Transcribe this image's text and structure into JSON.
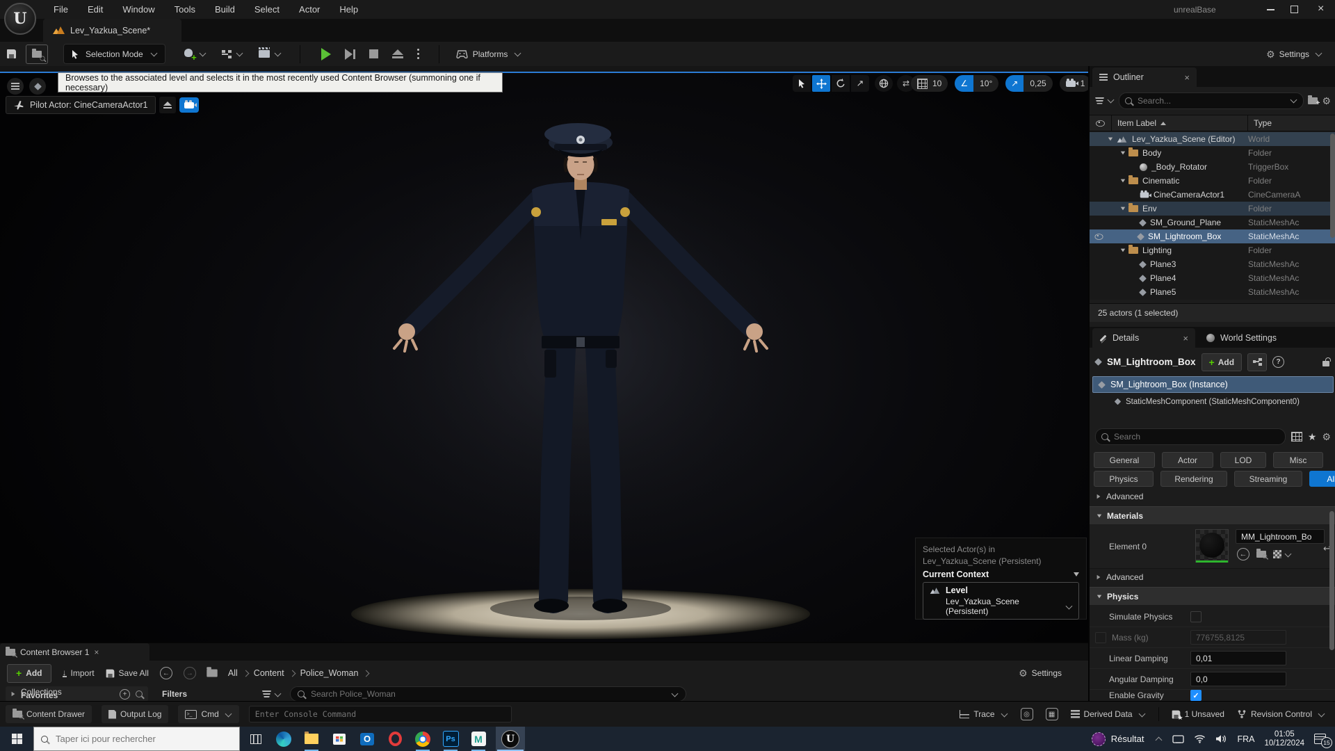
{
  "window": {
    "title": "unrealBase",
    "menu": [
      "File",
      "Edit",
      "Window",
      "Tools",
      "Build",
      "Select",
      "Actor",
      "Help"
    ],
    "tab": "Lev_Yazkua_Scene*"
  },
  "toolbar": {
    "selection_mode": "Selection Mode",
    "platforms": "Platforms",
    "settings": "Settings"
  },
  "tooltip": "Browses to the associated level and selects it in the most recently used Content Browser (summoning one if necessary)",
  "viewport": {
    "pilot": "Pilot Actor: CineCameraActor1",
    "grid_snap": "10",
    "angle_snap": "10°",
    "scale_snap": "0,25",
    "camera_speed": "1",
    "popup": {
      "line1": "Selected Actor(s) in",
      "line2": "Lev_Yazkua_Scene (Persistent)",
      "context": "Current Context",
      "level_label": "Level",
      "level_value": "Lev_Yazkua_Scene (Persistent)"
    }
  },
  "outliner": {
    "title": "Outliner",
    "search_placeholder": "Search...",
    "col_item": "Item Label",
    "col_type": "Type",
    "rows": [
      {
        "label": "Lev_Yazkua_Scene (Editor)",
        "type": "World"
      },
      {
        "label": "Body",
        "type": "Folder"
      },
      {
        "label": "_Body_Rotator",
        "type": "TriggerBox"
      },
      {
        "label": "Cinematic",
        "type": "Folder"
      },
      {
        "label": "CineCameraActor1",
        "type": "CineCameraA"
      },
      {
        "label": "Env",
        "type": "Folder"
      },
      {
        "label": "SM_Ground_Plane",
        "type": "StaticMeshAc"
      },
      {
        "label": "SM_Lightroom_Box",
        "type": "StaticMeshAc"
      },
      {
        "label": "Lighting",
        "type": "Folder"
      },
      {
        "label": "Plane3",
        "type": "StaticMeshAc"
      },
      {
        "label": "Plane4",
        "type": "StaticMeshAc"
      },
      {
        "label": "Plane5",
        "type": "StaticMeshAc"
      }
    ],
    "footer": "25 actors (1 selected)"
  },
  "details": {
    "tab_details": "Details",
    "tab_world": "World Settings",
    "object_name": "SM_Lightroom_Box",
    "add_button": "Add",
    "instance_label": "SM_Lightroom_Box (Instance)",
    "component_label": "StaticMeshComponent (StaticMeshComponent0)",
    "search_placeholder": "Search",
    "chips": [
      "General",
      "Actor",
      "LOD",
      "Misc",
      "Physics",
      "Rendering",
      "Streaming",
      "All"
    ],
    "advanced_label": "Advanced",
    "materials_label": "Materials",
    "element_label": "Element 0",
    "material_name": "MM_Lightroom_Bo",
    "physics_label": "Physics",
    "simulate_physics_label": "Simulate Physics",
    "mass_label": "Mass (kg)",
    "mass_value": "776755,8125",
    "linear_damping_label": "Linear Damping",
    "linear_damping_value": "0,01",
    "angular_damping_label": "Angular Damping",
    "angular_damping_value": "0,0",
    "enable_gravity_label": "Enable Gravity"
  },
  "content_browser": {
    "tab": "Content Browser 1",
    "add": "Add",
    "import": "Import",
    "save_all": "Save All",
    "breadcrumb": [
      "All",
      "Content",
      "Police_Woman"
    ],
    "settings": "Settings",
    "favorites": "Favorites",
    "collections": "Collections",
    "filters": "Filters",
    "search_placeholder": "Search Police_Woman"
  },
  "status_bar": {
    "content_drawer": "Content Drawer",
    "output_log": "Output Log",
    "cmd": "Cmd",
    "console_placeholder": "Enter Console Command",
    "trace": "Trace",
    "derived_data": "Derived Data",
    "unsaved": "1 Unsaved",
    "revision_control": "Revision Control"
  },
  "taskbar": {
    "search_placeholder": "Taper ici pour rechercher",
    "widget": "Résultat",
    "lang": "FRA",
    "time": "01:05",
    "date": "10/12/2024",
    "notif_count": "15"
  },
  "icons": {
    "search": "magnifier",
    "settings": "gear",
    "close": "×",
    "dropdown": "chevron-down",
    "expand": "triangle-down",
    "collapsed": "triangle-right"
  },
  "colors": {
    "accent_blue": "#0f76d1",
    "selection_row": "#466384",
    "check_blue": "#1f8fff",
    "play_green": "#5bc236",
    "folder_orange": "#bd8e4d",
    "tooltip_bg": "#f0f0ed"
  }
}
